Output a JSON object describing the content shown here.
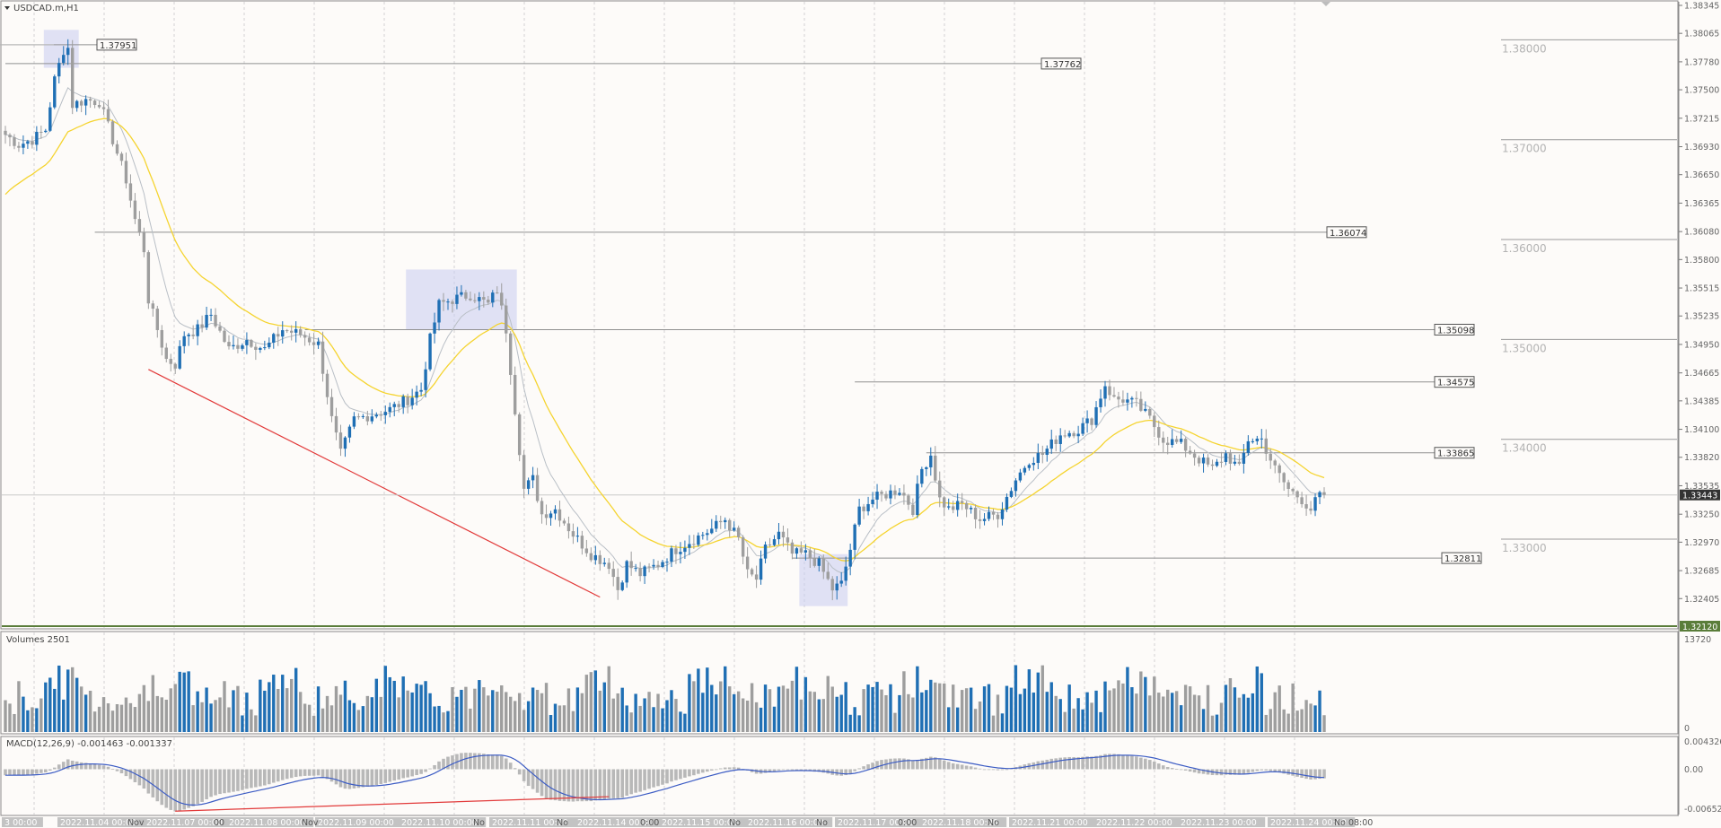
{
  "chart_title": "USDCAD.m,H1",
  "volumes_label": "Volumes 2501",
  "macd_label": "MACD(12,26,9) -0.001463 -0.001337",
  "colors": {
    "bull": "#1f6fb4",
    "bear": "#9e9e9e",
    "ma_fast": "#b9bfc6",
    "ma_slow": "#f5d430",
    "trend": "#e23a3a",
    "zone": "#c8ccf0",
    "level": "#909090",
    "current": "#333333",
    "low_marker": "#5a7d3a",
    "macd_signal": "#3c5cc4"
  },
  "chart_data": {
    "type": "candlestick",
    "symbol": "USDCAD.m",
    "timeframe": "H1",
    "ylim": [
      1.3212,
      1.38345
    ],
    "y_ticks": [
      "1.38345",
      "1.38065",
      "1.37780",
      "1.37500",
      "1.37215",
      "1.36930",
      "1.36650",
      "1.36365",
      "1.36080",
      "1.35800",
      "1.35515",
      "1.35235",
      "1.34950",
      "1.34665",
      "1.34385",
      "1.34100",
      "1.33820",
      "1.33535",
      "1.33250",
      "1.32970",
      "1.32685",
      "1.32405"
    ],
    "current_price": "1.33443",
    "low_marker": "1.32120",
    "close_path": [
      [
        0,
        1.3705
      ],
      [
        3,
        1.3695
      ],
      [
        6,
        1.37
      ],
      [
        9,
        1.371
      ],
      [
        11,
        1.376
      ],
      [
        13,
        1.379
      ],
      [
        14,
        1.3792
      ],
      [
        15,
        1.3735
      ],
      [
        18,
        1.374
      ],
      [
        21,
        1.3738
      ],
      [
        24,
        1.37
      ],
      [
        27,
        1.366
      ],
      [
        29,
        1.362
      ],
      [
        31,
        1.359
      ],
      [
        32,
        1.354
      ],
      [
        34,
        1.351
      ],
      [
        36,
        1.348
      ],
      [
        38,
        1.3475
      ],
      [
        40,
        1.3505
      ],
      [
        43,
        1.351
      ],
      [
        46,
        1.3525
      ],
      [
        50,
        1.349
      ],
      [
        54,
        1.35
      ],
      [
        58,
        1.349
      ],
      [
        62,
        1.351
      ],
      [
        66,
        1.3505
      ],
      [
        70,
        1.3495
      ],
      [
        73,
        1.342
      ],
      [
        75,
        1.3385
      ],
      [
        78,
        1.342
      ],
      [
        82,
        1.3425
      ],
      [
        86,
        1.343
      ],
      [
        90,
        1.344
      ],
      [
        93,
        1.345
      ],
      [
        95,
        1.35
      ],
      [
        97,
        1.3535
      ],
      [
        100,
        1.354
      ],
      [
        104,
        1.3545
      ],
      [
        108,
        1.3535
      ],
      [
        110,
        1.355
      ],
      [
        112,
        1.351
      ],
      [
        114,
        1.343
      ],
      [
        116,
        1.335
      ],
      [
        118,
        1.336
      ],
      [
        120,
        1.3325
      ],
      [
        123,
        1.333
      ],
      [
        127,
        1.3305
      ],
      [
        131,
        1.3285
      ],
      [
        135,
        1.3275
      ],
      [
        137,
        1.325
      ],
      [
        139,
        1.3275
      ],
      [
        142,
        1.3265
      ],
      [
        146,
        1.3275
      ],
      [
        150,
        1.329
      ],
      [
        154,
        1.33
      ],
      [
        158,
        1.331
      ],
      [
        161,
        1.332
      ],
      [
        164,
        1.33
      ],
      [
        166,
        1.3265
      ],
      [
        168,
        1.326
      ],
      [
        170,
        1.329
      ],
      [
        173,
        1.3305
      ],
      [
        176,
        1.3285
      ],
      [
        179,
        1.3285
      ],
      [
        182,
        1.3275
      ],
      [
        185,
        1.325
      ],
      [
        187,
        1.3255
      ],
      [
        189,
        1.329
      ],
      [
        191,
        1.333
      ],
      [
        194,
        1.334
      ],
      [
        197,
        1.3345
      ],
      [
        200,
        1.335
      ],
      [
        203,
        1.333
      ],
      [
        205,
        1.337
      ],
      [
        207,
        1.3385
      ],
      [
        209,
        1.334
      ],
      [
        211,
        1.333
      ],
      [
        214,
        1.3335
      ],
      [
        218,
        1.332
      ],
      [
        222,
        1.3325
      ],
      [
        226,
        1.336
      ],
      [
        229,
        1.338
      ],
      [
        232,
        1.3385
      ],
      [
        236,
        1.3405
      ],
      [
        240,
        1.341
      ],
      [
        243,
        1.342
      ],
      [
        246,
        1.3455
      ],
      [
        248,
        1.344
      ],
      [
        250,
        1.344
      ],
      [
        253,
        1.3435
      ],
      [
        256,
        1.342
      ],
      [
        259,
        1.34
      ],
      [
        263,
        1.3395
      ],
      [
        267,
        1.338
      ],
      [
        270,
        1.337
      ],
      [
        273,
        1.3385
      ],
      [
        276,
        1.337
      ],
      [
        278,
        1.34
      ],
      [
        281,
        1.34
      ],
      [
        284,
        1.337
      ],
      [
        287,
        1.335
      ],
      [
        290,
        1.334
      ],
      [
        292,
        1.333
      ],
      [
        294,
        1.3344
      ]
    ],
    "x_tick_labels": [
      "3 00:00",
      "2022.11.04 00:00",
      "2022.11.07 00:00",
      "2022.11.08 00:00",
      "2022.11.09 00:00",
      "2022.11.10 00:00",
      "2022.11.11 00:00",
      "2022.11.14 00:00",
      "2022.11.15 00:00",
      "2022.11.16 00:00",
      "2022.11.17 00:00",
      "2022.11.18 00:00",
      "2022.11.21 00:00",
      "2022.11.22 00:00",
      "2022.11.23 00:00",
      "2022.11.24 00:00"
    ],
    "x_extra_labels": [
      "Nov",
      "00",
      "Nov",
      "No",
      "No",
      "0:00",
      "No",
      "No",
      "0:00",
      "No",
      "No 08:00"
    ],
    "levels": [
      {
        "label": "1.37951",
        "price": 1.37951
      },
      {
        "label": "1.37762",
        "price": 1.37762
      },
      {
        "label": "1.36074",
        "price": 1.36074
      },
      {
        "label": "1.35098",
        "price": 1.35098
      },
      {
        "label": "1.34575",
        "price": 1.34575
      },
      {
        "label": "1.33865",
        "price": 1.33865
      },
      {
        "label": "1.32811",
        "price": 1.32811
      }
    ],
    "round_levels": [
      "1.38000",
      "1.37000",
      "1.36000",
      "1.35000",
      "1.34000",
      "1.33000"
    ],
    "zones": [
      {
        "start": 9,
        "end": 16,
        "top": 1.381,
        "bottom": 1.3772
      },
      {
        "start": 90,
        "end": 114,
        "top": 1.357,
        "bottom": 1.351
      },
      {
        "start": 178,
        "end": 188,
        "top": 1.3285,
        "bottom": 1.3233
      }
    ],
    "trendlines": [
      {
        "from": [
          32,
          1.347
        ],
        "to": [
          133,
          1.3242
        ]
      }
    ],
    "volume_axis": [
      "13720",
      "0"
    ],
    "macd_axis": [
      "0.004326",
      "0.00",
      "-0.006525"
    ],
    "macd_trendline": {
      "from": [
        38,
        -0.00642
      ],
      "to": [
        135,
        -0.0042
      ]
    }
  }
}
